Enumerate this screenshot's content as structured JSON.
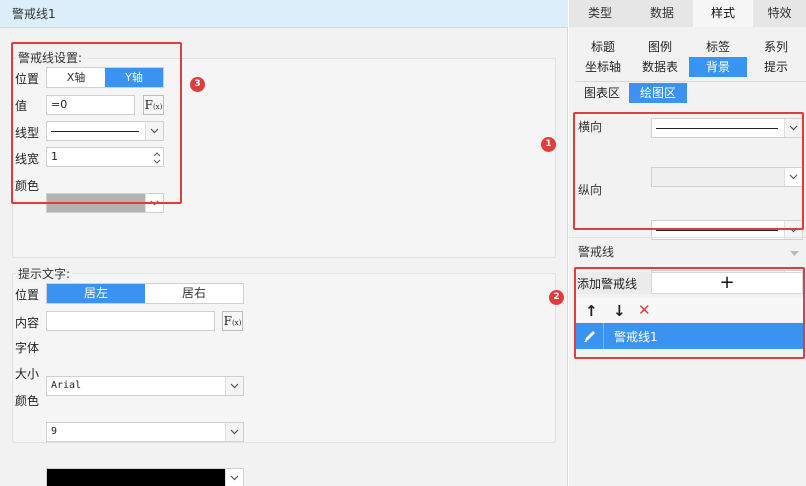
{
  "left_panel": {
    "title": "警戒线1",
    "line_settings": {
      "group_title": "警戒线设置:",
      "position_label": "位置",
      "axis_options": [
        "X轴",
        "Y轴"
      ],
      "axis_selected": "Y轴",
      "value_label": "值",
      "value_input": "=0",
      "linetype_label": "线型",
      "linewidth_label": "线宽",
      "linewidth_value": "1",
      "color_label": "颜色",
      "line_color": "#b3b3b3"
    },
    "tip_text": {
      "group_title": "提示文字:",
      "position_label": "位置",
      "position_options": [
        "居左",
        "居右"
      ],
      "position_selected": "居左",
      "content_label": "内容",
      "content_value": "",
      "font_label": "字体",
      "font_value": "Arial",
      "size_label": "大小",
      "size_value": "9",
      "color_label": "颜色",
      "text_color": "#000000"
    },
    "badge_3": "3"
  },
  "right_panel": {
    "top_tabs": [
      "类型",
      "数据",
      "样式",
      "特效"
    ],
    "top_tab_active": "样式",
    "sub_tabs_row1": [
      "标题",
      "图例",
      "标签",
      "系列"
    ],
    "sub_tabs_row2": [
      "坐标轴",
      "数据表",
      "背景",
      "提示"
    ],
    "sub_tab_active": "背景",
    "area_tabs": [
      "图表区",
      "绘图区"
    ],
    "area_tab_active": "绘图区",
    "grid": {
      "horizontal_label": "横向",
      "vertical_label": "纵向"
    },
    "badge_1": "1",
    "warning_line": {
      "section_title": "警戒线",
      "add_label": "添加警戒线",
      "add_symbol": "+",
      "items": [
        "警戒线1"
      ],
      "badge_2": "2"
    }
  },
  "icons": {
    "fx": "F(x)",
    "chevron": "chevron-down-icon",
    "up_arrow": "↑",
    "down_arrow": "↓",
    "delete": "✕",
    "edit": "pencil-icon"
  },
  "colors": {
    "accent": "#3a93f0",
    "annotation": "#e03c3c",
    "title_bar": "#dbeef9"
  }
}
